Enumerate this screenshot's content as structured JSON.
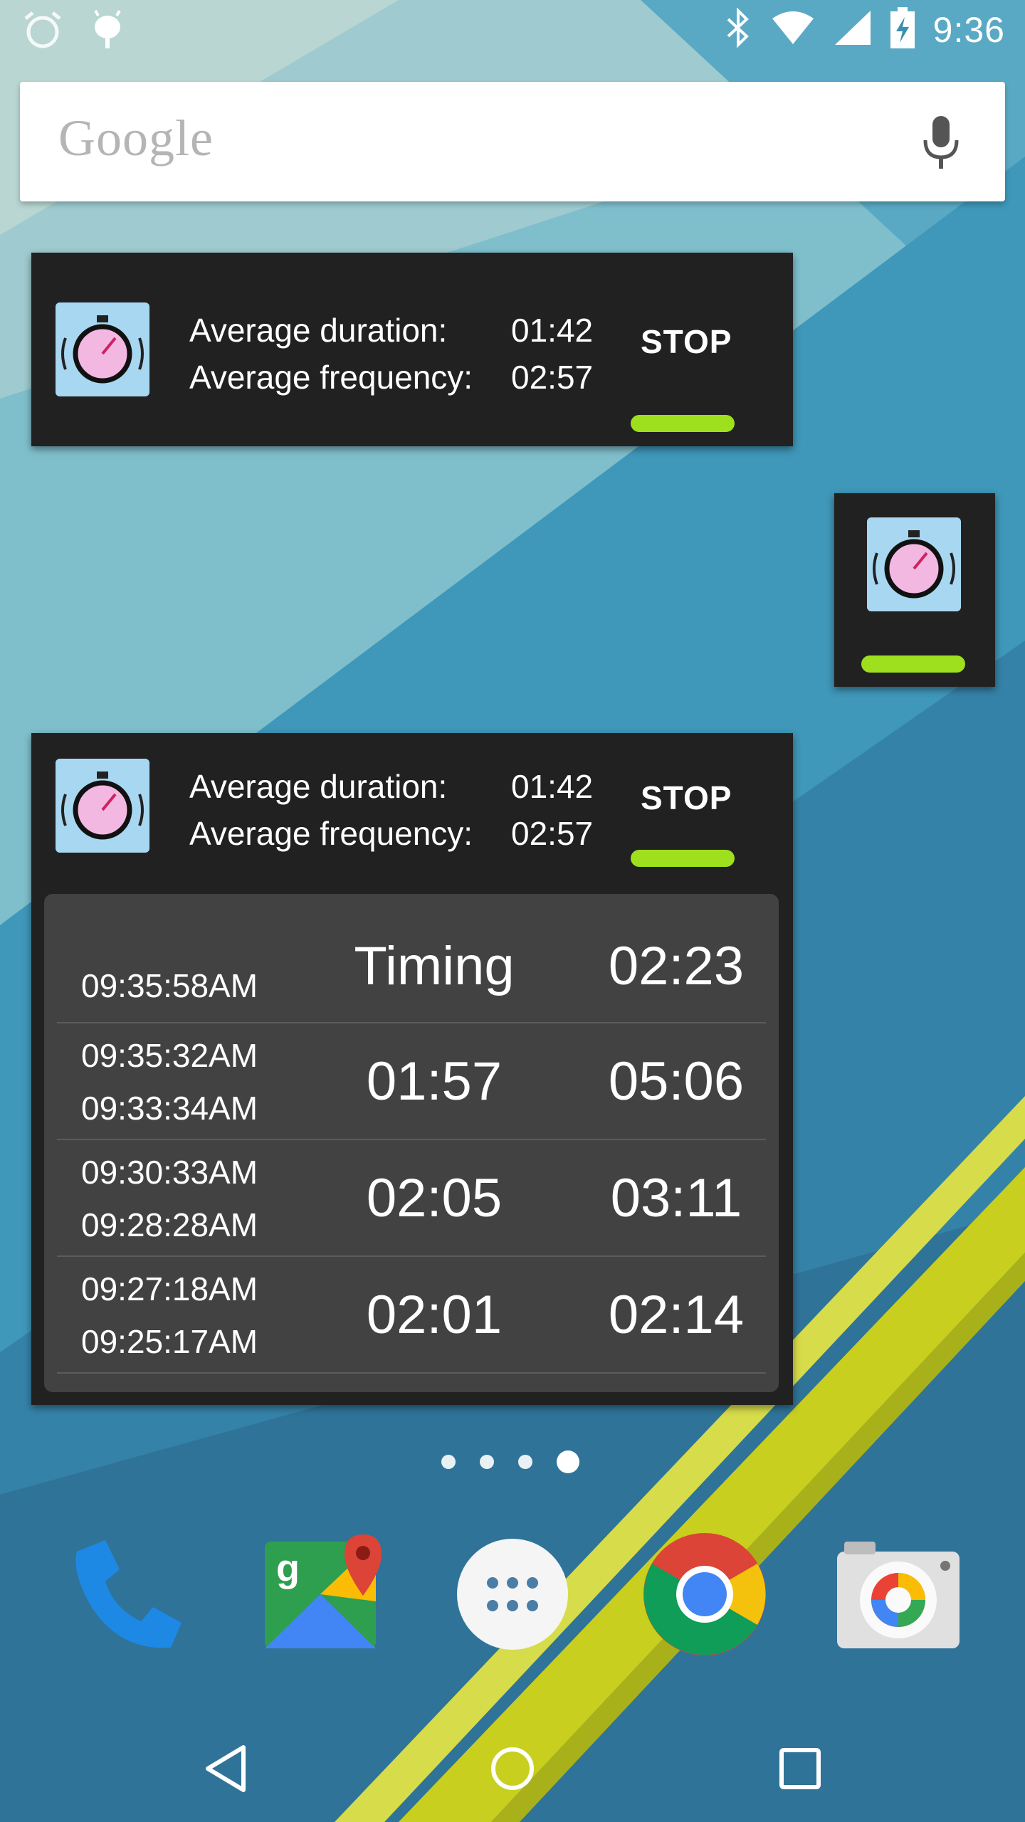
{
  "status_bar": {
    "time": "9:36",
    "left_icons": [
      "alarm-icon",
      "android-debug-icon"
    ],
    "right_icons": [
      "bluetooth-icon",
      "wifi-icon",
      "signal-icon",
      "battery-charging-icon"
    ]
  },
  "search": {
    "logo_text": "Google",
    "icon": "mic-icon"
  },
  "widget_small": {
    "labels": [
      "Average duration:",
      "Average frequency:"
    ],
    "values": [
      "01:42",
      "02:57"
    ],
    "stop_label": "STOP",
    "indicator_color": "#9ee01e"
  },
  "widget_large": {
    "labels": [
      "Average duration:",
      "Average frequency:"
    ],
    "values": [
      "01:42",
      "02:57"
    ],
    "stop_label": "STOP",
    "history": [
      {
        "start": "",
        "end": "09:35:58AM",
        "duration": "Timing",
        "interval": "02:23"
      },
      {
        "start": "09:35:32AM",
        "end": "09:33:34AM",
        "duration": "01:57",
        "interval": "05:06"
      },
      {
        "start": "09:30:33AM",
        "end": "09:28:28AM",
        "duration": "02:05",
        "interval": "03:11"
      },
      {
        "start": "09:27:18AM",
        "end": "09:25:17AM",
        "duration": "02:01",
        "interval": "02:14"
      }
    ]
  },
  "page_indicator": {
    "count": 4,
    "active": 4
  },
  "dock": [
    "phone-icon",
    "maps-icon",
    "app-drawer-icon",
    "chrome-icon",
    "camera-icon"
  ],
  "nav": [
    "back-icon",
    "home-icon",
    "recents-icon"
  ],
  "colors": {
    "widget_bg": "#212121",
    "history_bg": "#424242",
    "accent_green": "#9ee01e",
    "wallpaper_blue": "#4a9dbb"
  }
}
